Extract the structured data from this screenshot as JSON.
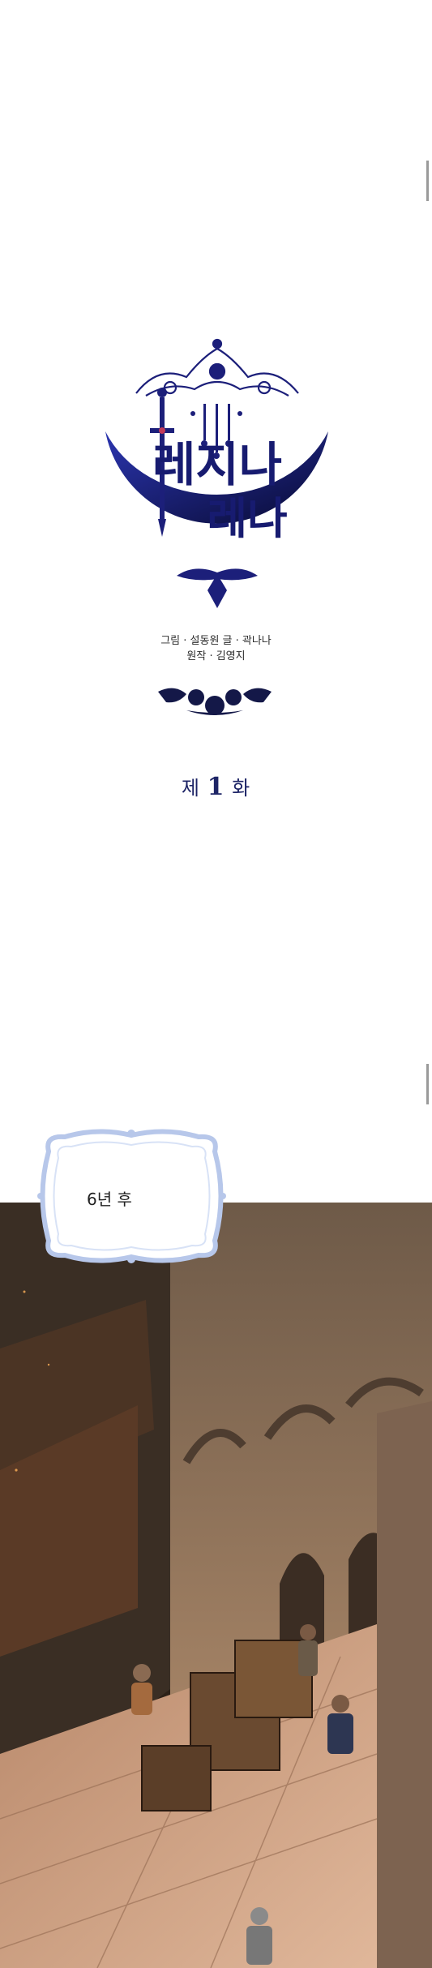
{
  "logo": {
    "title_line1": "레지나",
    "title_line2": "레나"
  },
  "credits": {
    "line1": "그림 · 설동원  글 · 곽나나",
    "line2": "원작 · 김영지"
  },
  "chapter": {
    "prefix": "제",
    "number": "1",
    "suffix": "화"
  },
  "caption": {
    "text": "6년 후"
  },
  "colors": {
    "logo_navy": "#1c1f7a",
    "logo_dark": "#0b0c3d",
    "chapter_text": "#1d2466",
    "caption_frame": "#b7c7ea",
    "scene_stone": "#8a6f55"
  }
}
